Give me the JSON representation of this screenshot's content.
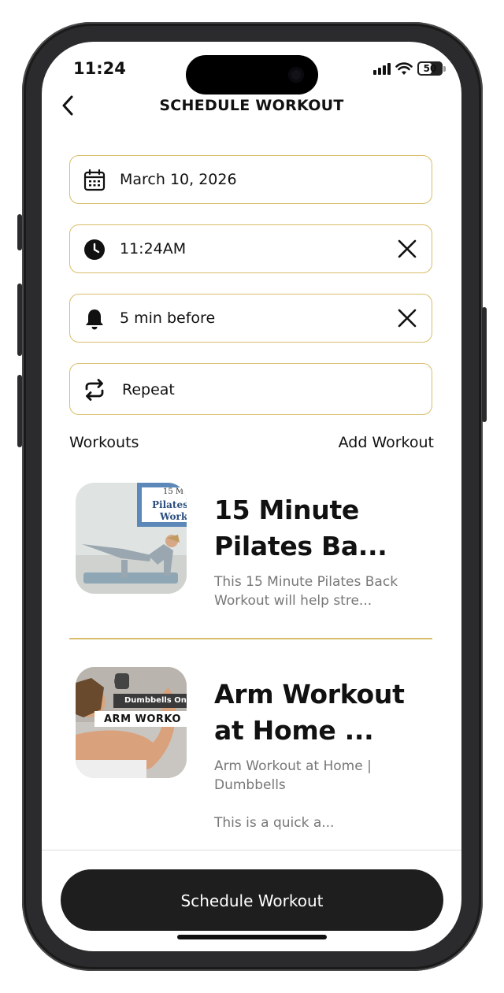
{
  "status": {
    "time": "11:24",
    "battery": "50"
  },
  "header": {
    "title": "SCHEDULE WORKOUT"
  },
  "fields": {
    "date": "March 10, 2026",
    "time": "11:24AM",
    "reminder": "5 min before",
    "repeat": "Repeat"
  },
  "workouts_section": {
    "label": "Workouts",
    "add_label": "Add Workout"
  },
  "workouts": [
    {
      "title": "15 Minute Pilates Ba...",
      "title_line1": "15 Minute",
      "title_line2": "Pilates Ba...",
      "desc_line1": "This 15 Minute Pilates Back",
      "desc_line2": "Workout will help stre...",
      "thumb_text_1": "15 M",
      "thumb_text_2": "Pilates",
      "thumb_text_3": "Work"
    },
    {
      "title": "Arm Workout at Home ...",
      "title_line1": "Arm Workout",
      "title_line2": "at Home ...",
      "desc_line1": "Arm Workout at Home |",
      "desc_line2": "Dumbbells",
      "desc_line3": "This is a quick a...",
      "thumb_text_1": "Dumbbells Only",
      "thumb_text_2": "ARM WORKO"
    }
  ],
  "cta": {
    "label": "Schedule Workout"
  },
  "colors": {
    "accent_border": "#d8bd6a",
    "cta_bg": "#1e1e1e",
    "text": "#111111",
    "muted": "#777777"
  }
}
